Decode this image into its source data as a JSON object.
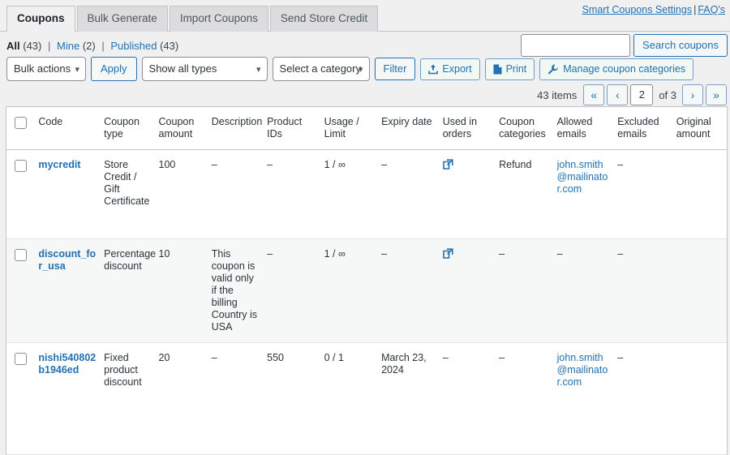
{
  "tabs": [
    {
      "label": "Coupons",
      "active": true
    },
    {
      "label": "Bulk Generate",
      "active": false
    },
    {
      "label": "Import Coupons",
      "active": false
    },
    {
      "label": "Send Store Credit",
      "active": false
    }
  ],
  "top_links": {
    "settings": "Smart Coupons Settings",
    "separator": "|",
    "faq": "FAQ's"
  },
  "status_filters": {
    "all_label": "All",
    "all_count": "(43)",
    "bar1": "|",
    "mine_label": "Mine",
    "mine_count": "(2)",
    "bar2": "|",
    "published_label": "Published",
    "published_count": "(43)"
  },
  "search": {
    "value": "",
    "placeholder": "",
    "button": "Search coupons"
  },
  "toolbar": {
    "bulk_actions": "Bulk actions",
    "apply": "Apply",
    "show_types": "Show all types",
    "select_category": "Select a category",
    "filter": "Filter",
    "export": "Export",
    "print": "Print",
    "manage_categories": "Manage coupon categories"
  },
  "pagination": {
    "items": "43 items",
    "first": "«",
    "prev": "‹",
    "current": "2",
    "of": "of 3",
    "next": "›",
    "last": "»"
  },
  "table": {
    "columns": [
      "Code",
      "Coupon type",
      "Coupon amount",
      "Description",
      "Product IDs",
      "Usage / Limit",
      "Expiry date",
      "Used in orders",
      "Coupon categories",
      "Allowed emails",
      "Excluded emails",
      "Original amount"
    ],
    "rows": [
      {
        "code": "mycredit",
        "coupon_type": "Store Credit / Gift Certificate",
        "coupon_amount": "100",
        "description": "–",
        "product_ids": "–",
        "usage_limit": "1 / ∞",
        "expiry_date": "–",
        "used_in_orders": "external-link-icon",
        "coupon_categories": "Refund",
        "allowed_emails": "john.smith@mailinator.com",
        "excluded_emails": "–",
        "original_amount": ""
      },
      {
        "code": "discount_for_usa",
        "coupon_type": "Percentage discount",
        "coupon_amount": "10",
        "description": "This coupon is valid only if the billing Country is USA",
        "product_ids": "–",
        "usage_limit": "1 / ∞",
        "expiry_date": "–",
        "used_in_orders": "external-link-icon",
        "coupon_categories": "–",
        "allowed_emails": "–",
        "excluded_emails": "–",
        "original_amount": ""
      },
      {
        "code": "nishi540802b1946ed",
        "coupon_type": "Fixed product discount",
        "coupon_amount": "20",
        "description": "–",
        "product_ids": "550",
        "usage_limit": "0 / 1",
        "expiry_date": "March 23, 2024",
        "used_in_orders": "–",
        "coupon_categories": "–",
        "allowed_emails": "john.smith@mailinator.com",
        "excluded_emails": "–",
        "original_amount": ""
      }
    ]
  },
  "colors": {
    "link": "#2271b1",
    "page_bg": "#f0f0f1",
    "border": "#c3c4c7"
  }
}
